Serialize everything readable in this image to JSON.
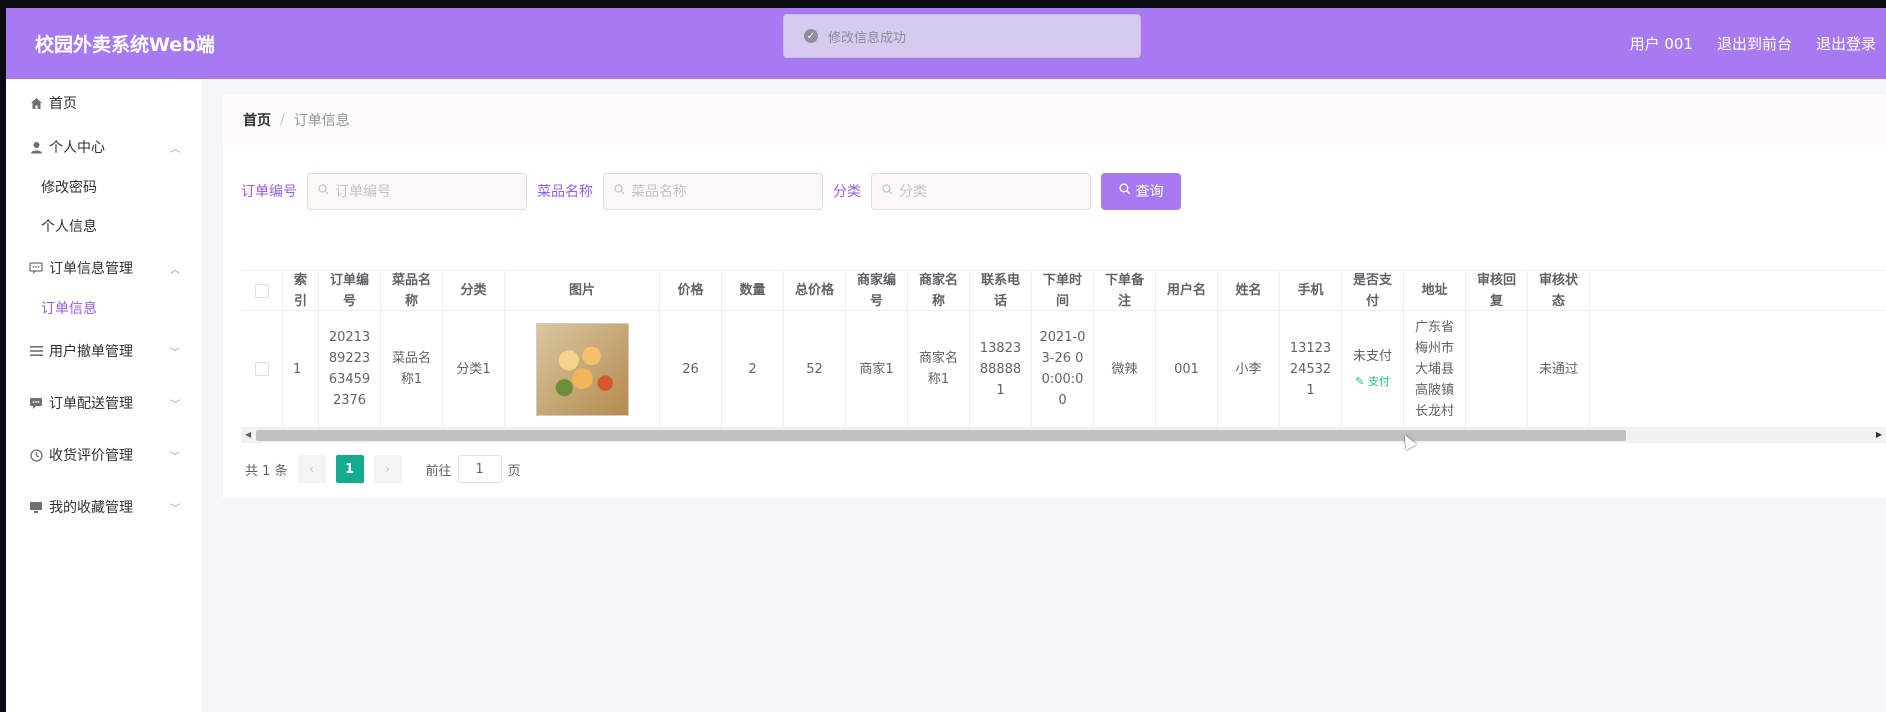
{
  "topbar": {
    "brand": "校园外卖系统Web端",
    "links": [
      "用户 001",
      "退出到前台",
      "退出登录"
    ],
    "toast": "修改信息成功"
  },
  "sidebar": {
    "home": "首页",
    "personal": "个人中心",
    "personal_sub": [
      "修改密码",
      "个人信息"
    ],
    "orders": "订单信息管理",
    "orders_sub": [
      "订单信息"
    ],
    "groups": [
      "用户撤单管理",
      "订单配送管理",
      "收货评价管理",
      "我的收藏管理"
    ]
  },
  "breadcrumb": {
    "home": "首页",
    "sep": "/",
    "current": "订单信息"
  },
  "search": {
    "fields": [
      {
        "label": "订单编号",
        "placeholder": "订单编号"
      },
      {
        "label": "菜品名称",
        "placeholder": "菜品名称"
      },
      {
        "label": "分类",
        "placeholder": "分类"
      }
    ],
    "button": "查询"
  },
  "table": {
    "headers": [
      "索引",
      "订单编号",
      "菜品名称",
      "分类",
      "图片",
      "价格",
      "数量",
      "总价格",
      "商家编号",
      "商家名称",
      "联系电话",
      "下单时间",
      "下单备注",
      "用户名",
      "姓名",
      "手机",
      "是否支付",
      "地址",
      "审核回复",
      "审核状态"
    ],
    "rows": [
      {
        "index": "1",
        "order_no": "202138922363459​2376",
        "dish": "菜品名称1",
        "category": "分类1",
        "price": "26",
        "qty": "2",
        "total": "52",
        "merchant_no": "商家1",
        "merchant_name": "商家名称1",
        "phone": "13823888881",
        "time": "2021-03-26 00:00:00",
        "note": "微辣",
        "username": "001",
        "name": "小李",
        "mobile": "13123245321",
        "paid": "未支付",
        "pay_action": "支付",
        "address": "广东省梅州市大埔县高陂镇长龙村",
        "reply": "",
        "status": "未通过"
      }
    ]
  },
  "pager": {
    "total": "共 1 条",
    "current": "1",
    "goto": "前往",
    "page_value": "1",
    "page_unit": "页"
  }
}
